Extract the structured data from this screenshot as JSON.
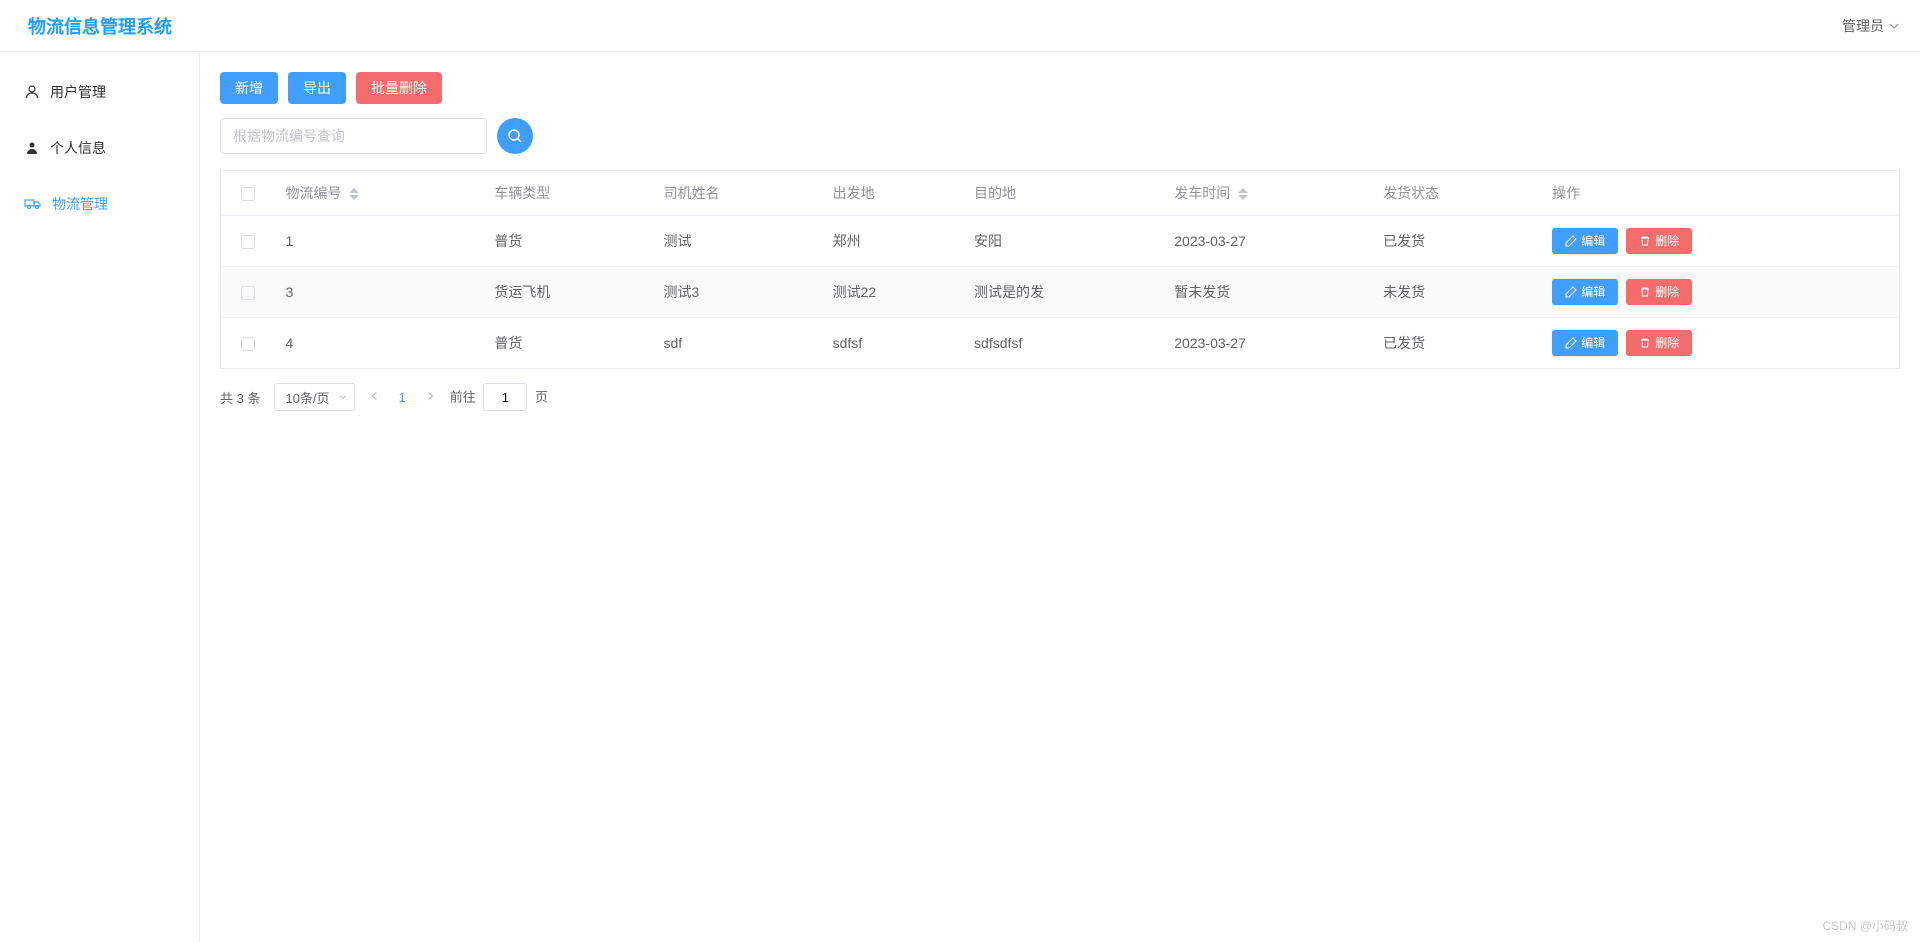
{
  "header": {
    "app_title": "物流信息管理系统",
    "user_label": "管理员"
  },
  "sidebar": {
    "items": [
      {
        "label": "用户管理",
        "active": false
      },
      {
        "label": "个人信息",
        "active": false
      },
      {
        "label": "物流管理",
        "active": true
      }
    ]
  },
  "toolbar": {
    "add_label": "新增",
    "export_label": "导出",
    "batch_delete_label": "批量删除"
  },
  "search": {
    "placeholder": "根据物流编号查询"
  },
  "table": {
    "columns": {
      "logistics_no": "物流编号",
      "vehicle_type": "车辆类型",
      "driver_name": "司机姓名",
      "origin": "出发地",
      "destination": "目的地",
      "depart_time": "发车时间",
      "ship_status": "发货状态",
      "actions": "操作"
    },
    "rows": [
      {
        "logistics_no": "1",
        "vehicle_type": "普货",
        "driver_name": "测试",
        "origin": "郑州",
        "destination": "安阳",
        "depart_time": "2023-03-27",
        "ship_status": "已发货"
      },
      {
        "logistics_no": "3",
        "vehicle_type": "货运飞机",
        "driver_name": "测试3",
        "origin": "测试22",
        "destination": "测试是的发",
        "depart_time": "暂未发货",
        "ship_status": "未发货"
      },
      {
        "logistics_no": "4",
        "vehicle_type": "普货",
        "driver_name": "sdf",
        "origin": "sdfsf",
        "destination": "sdfsdfsf",
        "depart_time": "2023-03-27",
        "ship_status": "已发货"
      }
    ],
    "action_labels": {
      "edit": "编辑",
      "delete": "删除"
    }
  },
  "pagination": {
    "total_text": "共 3 条",
    "page_size_label": "10条/页",
    "current_page": "1",
    "jump_prefix": "前往",
    "jump_value": "1",
    "jump_suffix": "页"
  },
  "watermark": "CSDN @小码叔"
}
